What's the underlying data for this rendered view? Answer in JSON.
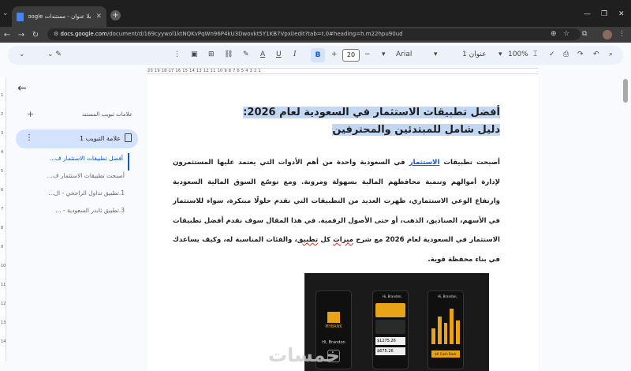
{
  "browser": {
    "tab_title": "بلا عنوان - مستندات Google",
    "url_domain": "docs.google.com",
    "url_path": "/document/d/169cyywol1ktNQKvPqWn96P4kU3Dwovkt5Y1KB7Vpxl/edit?tab=t.0#heading=h.m22hpu90ud"
  },
  "toolbar": {
    "font_size": "20",
    "font_name": "Arial",
    "style": "عنوان 1",
    "zoom": "100%",
    "bold": "B",
    "italic": "I",
    "underline": "U",
    "text_color": "A",
    "minus": "−",
    "plus": "+"
  },
  "ruler": {
    "marks": "20   19   18   17   16   15   14   13   12   11   10   9   8   7   6   5   4   3   2   1"
  },
  "vruler": [
    "1",
    "2",
    "3",
    "4",
    "5",
    "6",
    "7",
    "8",
    "9",
    "10",
    "11",
    "12",
    "13",
    "14"
  ],
  "sidebar": {
    "header": "علامات تبويب المستند",
    "tab_label": "علامة التبويب 1",
    "outline": [
      "أفضل تطبيقات الاستثمار ف...",
      "أصبحت تطبيقات الاستثمار ف...",
      "1.تطبيق تداول الراجحي - ال...",
      "3.تطبيق ثاندر السعودية - ..."
    ]
  },
  "document": {
    "heading": "أفضل تطبيقات الاستثمار في السعودية لعام 2026: دليل شامل للمبتدئين والمحترفين",
    "p_start": "أصبحت تطبيقات ",
    "p_link": "الاستثمار",
    "p_mid": " في السعودية واحدة من أهم الأدوات التي يعتمد عليها المستثمرون لإدارة أموالهم وتنمية محافظهم المالية بسهولة ومرونة. ومع توسّع السوق المالية السعودية وارتفاع الوعي الاستثماري، ظهرت العديد من التطبيقات التي تقدم حلولًا مبتكرة، سواء للاستثمار في الأسهم، الصناديق، الذهب، أو حتى الأصول الرقمية. في هذا المقال سوف نقدم أفضل تطبيقات الاستثمار في السعودية لعام 2026 مع شرح ",
    "p_sq1": "ميزات",
    "p_mid2": " كل ",
    "p_sq2": "تطبيق",
    "p_end": "، والفئات المناسبة له، وكيف يساعدك في بناء محفظة قوية."
  },
  "image": {
    "brand": "MYBANK",
    "greeting": "Hi, Brandon",
    "greeting2": "Hi, Brandon,",
    "amount1": "$1275.26",
    "amount2": "$675.26",
    "cta": "$0 Cash Back"
  },
  "watermark": "خمسات"
}
